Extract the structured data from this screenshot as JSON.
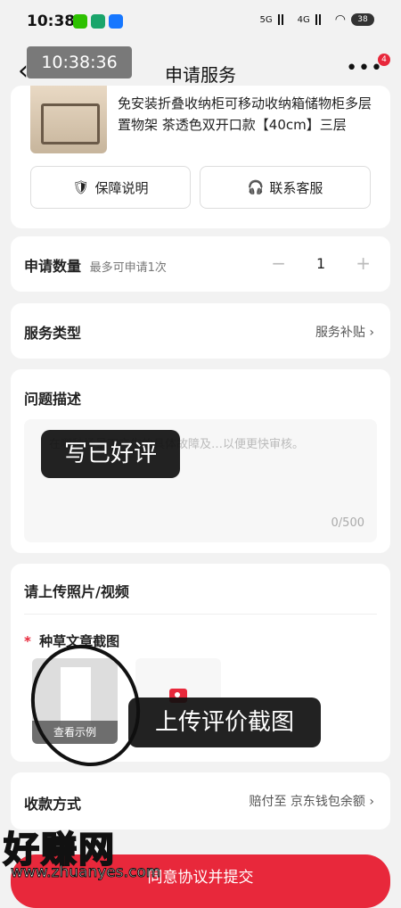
{
  "status_bar": {
    "time": "10:38",
    "signal_1": "5G",
    "signal_2": "4G",
    "battery": "38"
  },
  "nav": {
    "title": "申请服务",
    "badge": "4"
  },
  "overlay": {
    "time": "10:38:36"
  },
  "product": {
    "title": "免安装折叠收纳柜可移动收纳箱储物柜多层置物架 茶透色双开口款【40cm】三层",
    "guarantee_label": "保障说明",
    "service_label": "联系客服"
  },
  "quantity": {
    "label": "申请数量",
    "note": "最多可申请1次",
    "minus": "−",
    "value": "1",
    "plus": "+"
  },
  "service_type": {
    "label": "服务类型",
    "value": "服务补贴"
  },
  "description": {
    "label": "问题描述",
    "placeholder": "在哪种场景下产生的具体故障及…以便更快审核。",
    "counter": "0/500",
    "caption": "写已好评"
  },
  "upload": {
    "title": "请上传照片/视频",
    "required_label": "种草文章截图",
    "example_label": "查看示例",
    "caption": "上传评价截图"
  },
  "payment": {
    "label": "收款方式",
    "value": "赔付至 京东钱包余额"
  },
  "submit": {
    "label": "同意协议并提交"
  },
  "watermark": {
    "text": "好赚网",
    "url": "www.zhuanyes.com"
  }
}
